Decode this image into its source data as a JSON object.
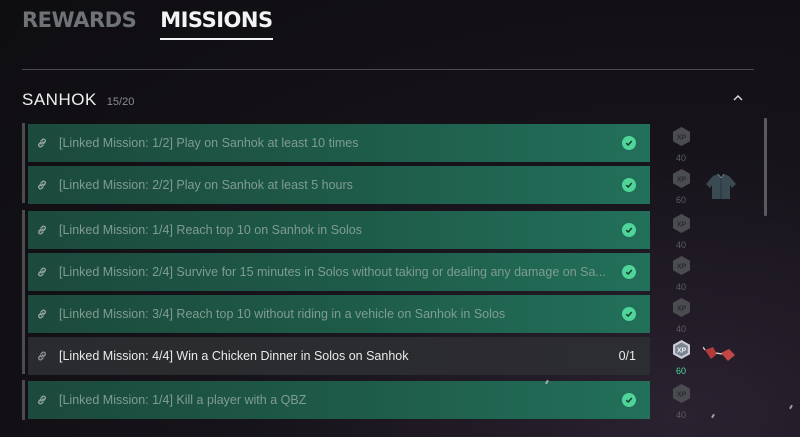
{
  "tabs": [
    {
      "label": "REWARDS",
      "active": false
    },
    {
      "label": "MISSIONS",
      "active": true
    }
  ],
  "section": {
    "title": "SANHOK",
    "count": "15/20"
  },
  "icons": {
    "collapse": "chevron-up-icon",
    "link": "link-icon",
    "complete": "check-circle-icon",
    "xp": "xp-hex-icon"
  },
  "colors": {
    "accent_green": "#4fd49a",
    "completed_row": "#1e5a48",
    "pending_row": "#2b2c2f"
  },
  "missions": [
    {
      "text": "[Linked Mission: 1/2] Play on Sanhok at least 10 times",
      "status": "complete",
      "xp": "40"
    },
    {
      "text": "[Linked Mission: 2/2] Play on Sanhok at least 5 hours",
      "status": "complete",
      "xp": "60",
      "bonus": "jacket-icon"
    },
    {
      "text": "[Linked Mission: 1/4] Reach top 10 on Sanhok in Solos",
      "status": "complete",
      "xp": "40"
    },
    {
      "text": "[Linked Mission: 2/4] Survive for 15 minutes in Solos without taking or dealing any damage on Sa...",
      "status": "complete",
      "xp": "40"
    },
    {
      "text": "[Linked Mission: 3/4] Reach top 10 without riding in a vehicle on Sanhok in Solos",
      "status": "complete",
      "xp": "40"
    },
    {
      "text": "[Linked Mission: 4/4] Win a Chicken Dinner in Solos on Sanhok",
      "status": "pending",
      "progress": "0/1",
      "xp": "60",
      "bonus": "sunglasses-icon"
    },
    {
      "text": "[Linked Mission: 1/4] Kill a player with a QBZ",
      "status": "complete",
      "xp": "40"
    }
  ],
  "xp_label": "XP"
}
